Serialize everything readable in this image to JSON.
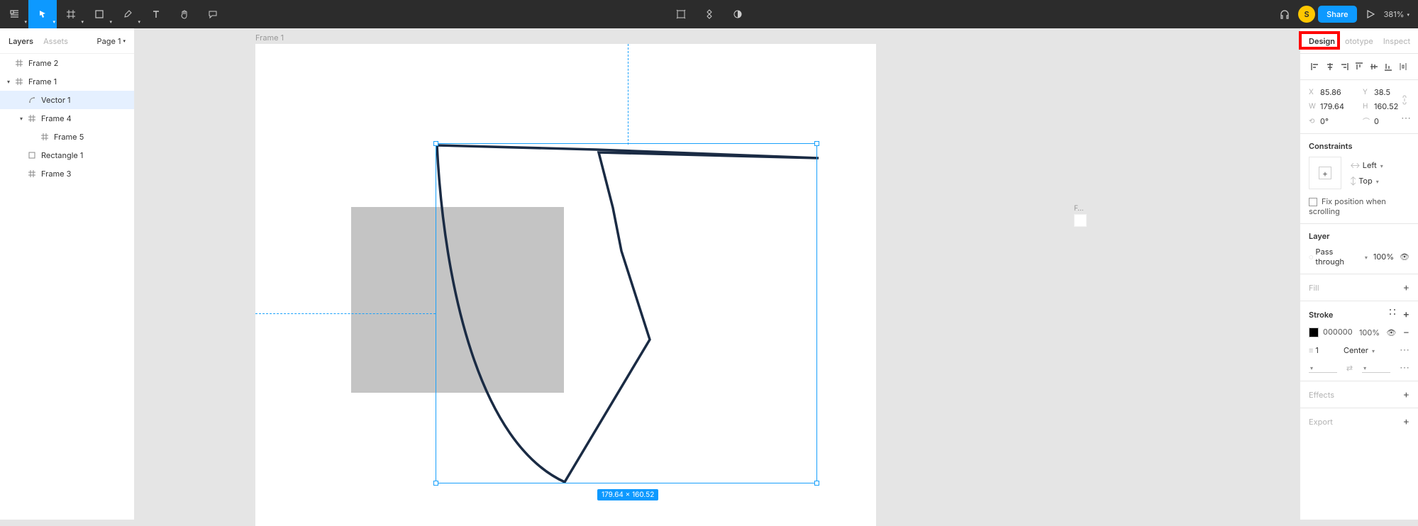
{
  "toolbar": {
    "zoom_label": "381%"
  },
  "avatar_letter": "S",
  "share_label": "Share",
  "left_panel": {
    "tab_layers": "Layers",
    "tab_assets": "Assets",
    "page_selector": "Page 1",
    "layers": [
      {
        "name": "Frame 2"
      },
      {
        "name": "Frame 1"
      },
      {
        "name": "Vector 1"
      },
      {
        "name": "Frame 4"
      },
      {
        "name": "Frame 5"
      },
      {
        "name": "Rectangle 1"
      },
      {
        "name": "Frame 3"
      }
    ]
  },
  "canvas": {
    "frame1_label": "Frame 1",
    "frame_tiny_label": "F…",
    "size_badge": "179.64 × 160.52"
  },
  "right_panel": {
    "tab_design": "Design",
    "tab_prototype": "ototype",
    "tab_inspect": "Inspect",
    "position": {
      "x_label": "X",
      "x_value": "85.86",
      "y_label": "Y",
      "y_value": "38.5",
      "w_label": "W",
      "w_value": "179.64",
      "h_label": "H",
      "h_value": "160.52",
      "rot_label": "⟲",
      "rot_value": "0°",
      "rad_label": "◠",
      "rad_value": "0"
    },
    "constraints_title": "Constraints",
    "constraint_h": "Left",
    "constraint_v": "Top",
    "fix_scroll": "Fix position when scrolling",
    "layer_title": "Layer",
    "blend_mode": "Pass through",
    "layer_opacity": "100%",
    "fill_title": "Fill",
    "stroke_title": "Stroke",
    "stroke_hex": "000000",
    "stroke_opacity": "100%",
    "stroke_weight": "1",
    "stroke_align": "Center",
    "effects_title": "Effects",
    "export_title": "Export"
  }
}
